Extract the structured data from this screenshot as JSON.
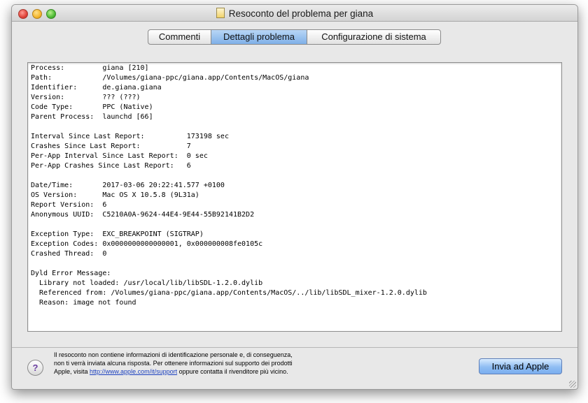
{
  "window": {
    "title": "Resoconto del problema per giana"
  },
  "tabs": [
    {
      "label": "Commenti",
      "active": false
    },
    {
      "label": "Dettagli problema",
      "active": true
    },
    {
      "label": "Configurazione di sistema",
      "active": false
    }
  ],
  "report": {
    "text": "Process:         giana [210]\nPath:            /Volumes/giana-ppc/giana.app/Contents/MacOS/giana\nIdentifier:      de.giana.giana\nVersion:         ??? (???)\nCode Type:       PPC (Native)\nParent Process:  launchd [66]\n\nInterval Since Last Report:          173198 sec\nCrashes Since Last Report:           7\nPer-App Interval Since Last Report:  0 sec\nPer-App Crashes Since Last Report:   6\n\nDate/Time:       2017-03-06 20:22:41.577 +0100\nOS Version:      Mac OS X 10.5.8 (9L31a)\nReport Version:  6\nAnonymous UUID:  C5210A0A-9624-44E4-9E44-55B92141B2D2\n\nException Type:  EXC_BREAKPOINT (SIGTRAP)\nException Codes: 0x0000000000000001, 0x000000008fe0105c\nCrashed Thread:  0\n\nDyld Error Message:\n  Library not loaded: /usr/local/lib/libSDL-1.2.0.dylib\n  Referenced from: /Volumes/giana-ppc/giana.app/Contents/MacOS/../lib/libSDL_mixer-1.2.0.dylib\n  Reason: image not found"
  },
  "footer": {
    "help_label": "?",
    "line1": "Il resoconto non contiene informazioni di identificazione personale e, di conseguenza,",
    "line2": "non ti verrà inviata alcuna risposta. Per ottenere informazioni sul supporto dei prodotti",
    "line3_prefix": "Apple, visita ",
    "link": "http://www.apple.com/it/support",
    "line3_suffix": " oppure contatta il rivenditore più vicino.",
    "send_button": "Invia ad Apple"
  },
  "icons": {
    "close": "close-button-icon",
    "minimize": "minimize-button-icon",
    "zoom": "zoom-button-icon",
    "title_doc": "document-icon",
    "help": "help-icon"
  }
}
